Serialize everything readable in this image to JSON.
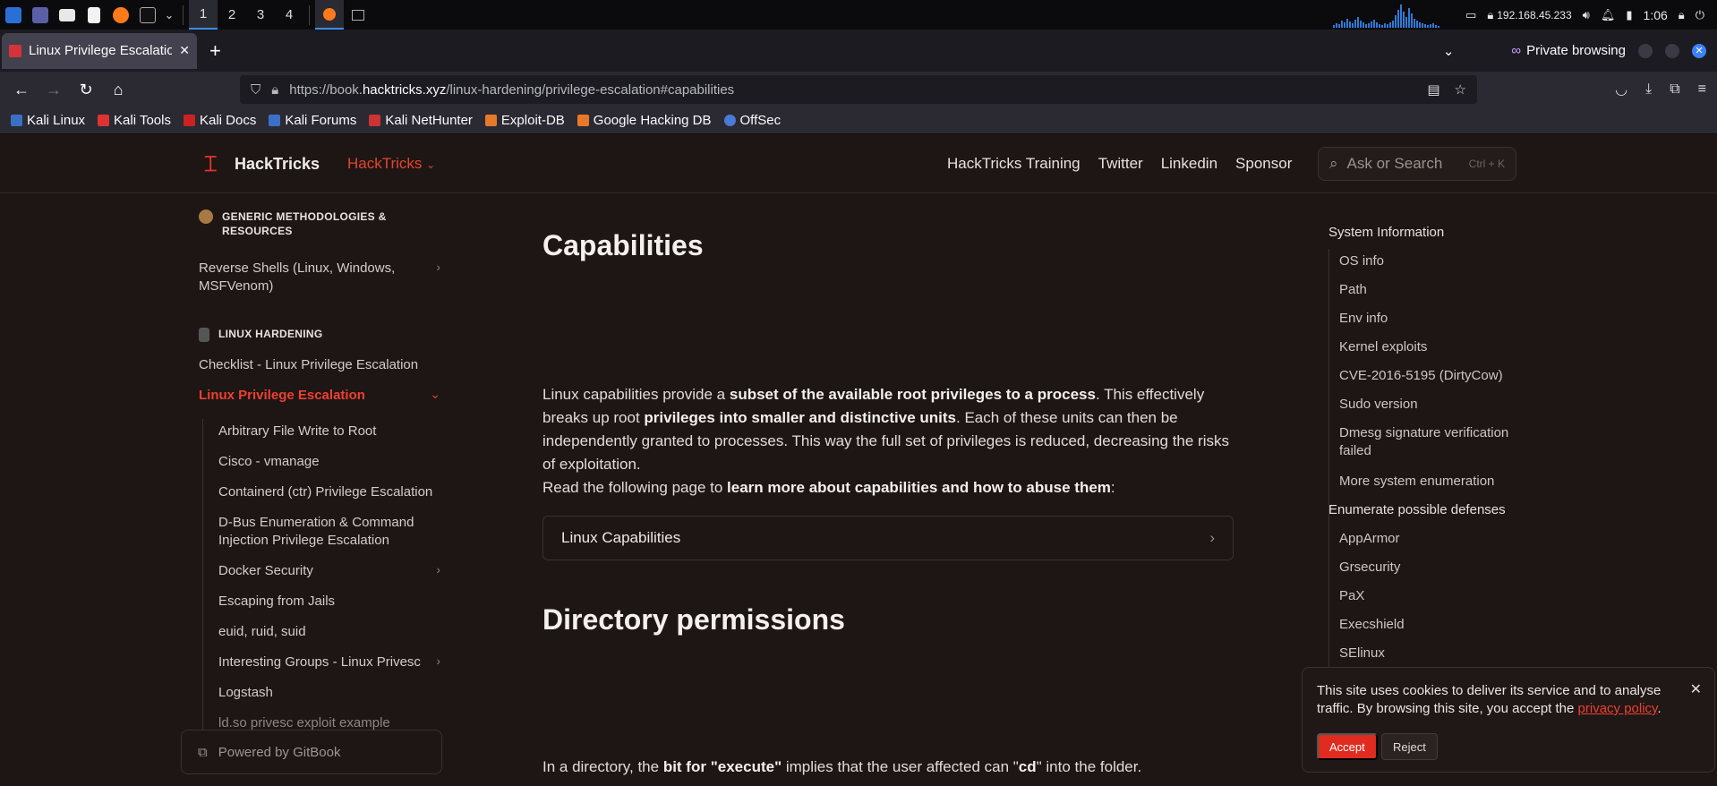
{
  "taskbar": {
    "workspaces": [
      "1",
      "2",
      "3",
      "4"
    ],
    "ip": "192.168.45.233",
    "time": "1:06"
  },
  "browser": {
    "tab_title": "Linux Privilege Escalation",
    "private_label": "Private browsing",
    "url_prefix": "https://book.",
    "url_host": "hacktricks.xyz",
    "url_path": "/linux-hardening/privilege-escalation#capabilities",
    "bookmarks": [
      "Kali Linux",
      "Kali Tools",
      "Kali Docs",
      "Kali Forums",
      "Kali NetHunter",
      "Exploit-DB",
      "Google Hacking DB",
      "OffSec"
    ]
  },
  "header": {
    "site_name": "HackTricks",
    "space": "HackTricks",
    "links": [
      "HackTricks Training",
      "Twitter",
      "Linkedin",
      "Sponsor"
    ],
    "search_placeholder": "Ask or Search",
    "search_shortcut": "Ctrl + K"
  },
  "sidebar": {
    "section1": "GENERIC METHODOLOGIES & RESOURCES",
    "reverse_shells": "Reverse Shells (Linux, Windows, MSFVenom)",
    "section2": "LINUX HARDENING",
    "checklist": "Checklist - Linux Privilege Escalation",
    "active": "Linux Privilege Escalation",
    "children": [
      "Arbitrary File Write to Root",
      "Cisco - vmanage",
      "Containerd (ctr) Privilege Escalation",
      "D-Bus Enumeration & Command Injection Privilege Escalation",
      "Docker Security",
      "Escaping from Jails",
      "euid, ruid, suid",
      "Interesting Groups - Linux Privesc",
      "Logstash",
      "ld.so privesc exploit example"
    ],
    "gitbook": "Powered by GitBook"
  },
  "main": {
    "h1": "Capabilities",
    "p1_a": "Linux capabilities provide a ",
    "p1_b": "subset of the available root privileges to a process",
    "p1_c": ". This effectively breaks up root ",
    "p1_d": "privileges into smaller and distinctive units",
    "p1_e": ". Each of these units can then be independently granted to processes. This way the full set of privileges is reduced, decreasing the risks of exploitation.",
    "p2_a": "Read the following page to ",
    "p2_b": "learn more about capabilities and how to abuse them",
    "p2_c": ":",
    "card": "Linux Capabilities",
    "h2": "Directory permissions",
    "p3_a": "In a directory, the ",
    "p3_b": "bit for \"execute\"",
    "p3_c": " implies that the user affected can \"",
    "p3_d": "cd",
    "p3_e": "\" into the folder."
  },
  "toc": {
    "items": [
      {
        "text": "System Information",
        "level": 1
      },
      {
        "text": "OS info",
        "level": 2
      },
      {
        "text": "Path",
        "level": 2
      },
      {
        "text": "Env info",
        "level": 2
      },
      {
        "text": "Kernel exploits",
        "level": 2
      },
      {
        "text": "CVE-2016-5195 (DirtyCow)",
        "level": 2
      },
      {
        "text": "Sudo version",
        "level": 2
      },
      {
        "text": "Dmesg signature verification failed",
        "level": 2
      },
      {
        "text": "More system enumeration",
        "level": 2
      },
      {
        "text": "Enumerate possible defenses",
        "level": 1
      },
      {
        "text": "AppArmor",
        "level": 2
      },
      {
        "text": "Grsecurity",
        "level": 2
      },
      {
        "text": "PaX",
        "level": 2
      },
      {
        "text": "Execshield",
        "level": 2
      },
      {
        "text": "SElinux",
        "level": 2
      }
    ]
  },
  "cookie": {
    "msg": "This site uses cookies to deliver its service and to analyse traffic. By browsing this site, you accept the ",
    "link": "privacy policy",
    "end": ".",
    "accept": "Accept",
    "reject": "Reject"
  }
}
